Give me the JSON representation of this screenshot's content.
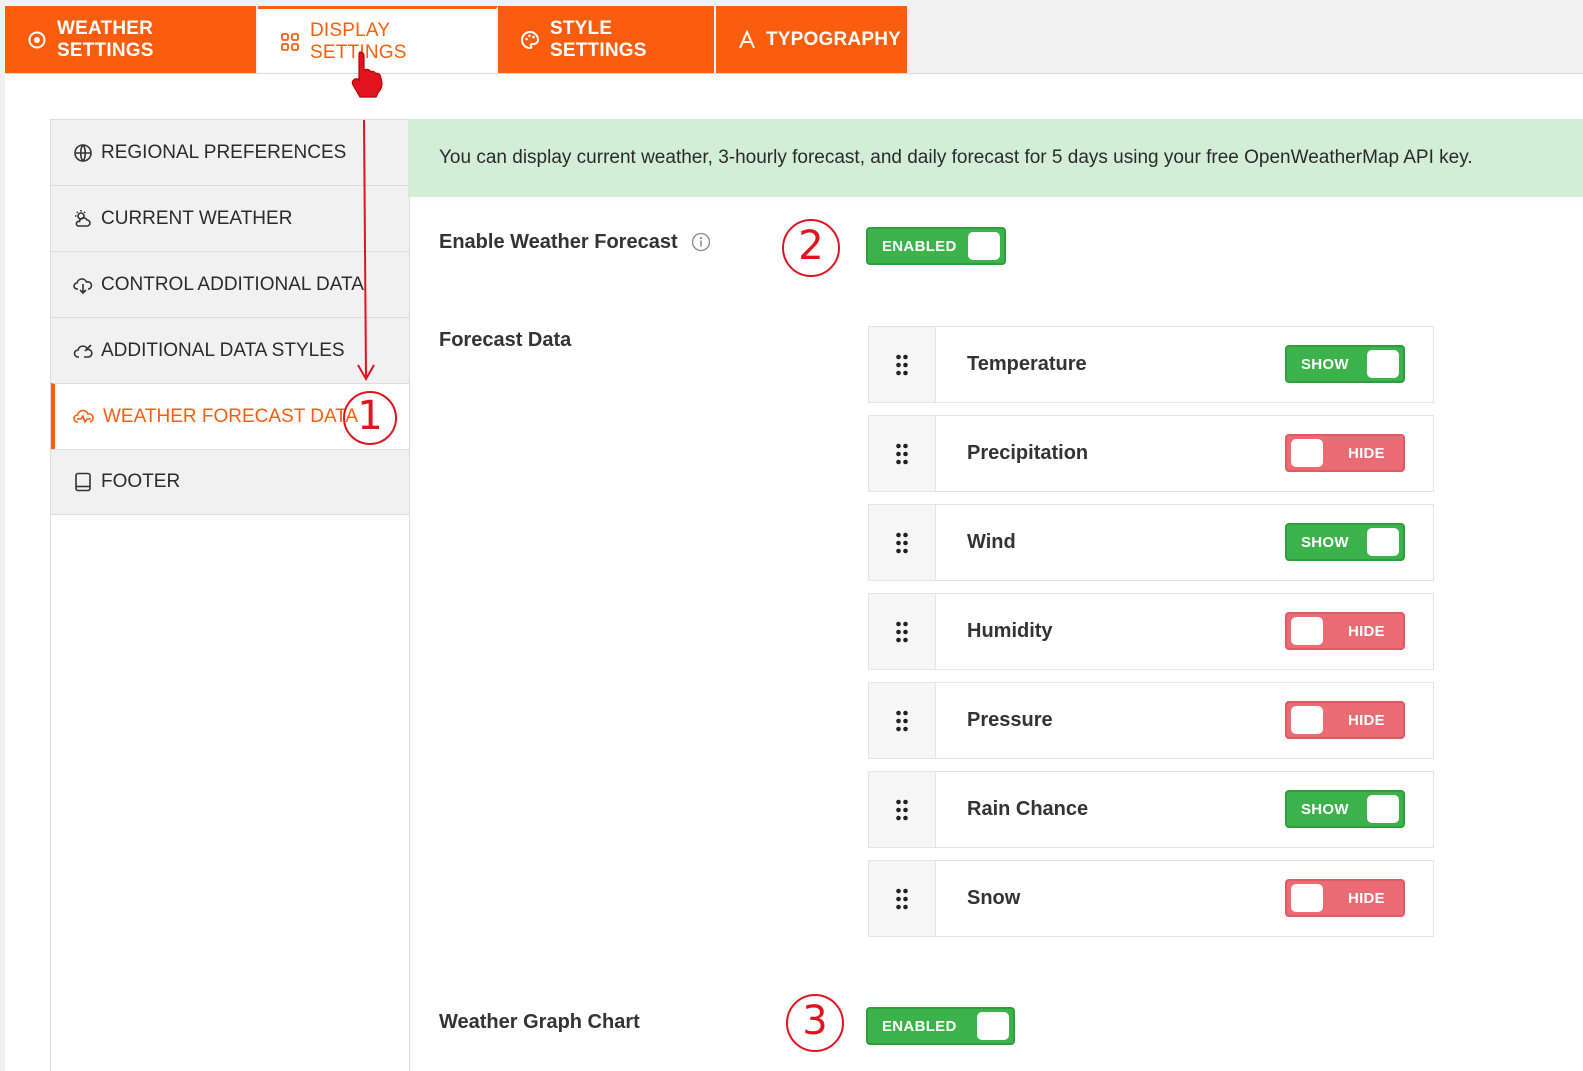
{
  "tabs": [
    {
      "label": "WEATHER SETTINGS",
      "icon": "weather-settings-icon"
    },
    {
      "label": "DISPLAY SETTINGS",
      "icon": "grid-icon"
    },
    {
      "label": "STYLE SETTINGS",
      "icon": "palette-icon"
    },
    {
      "label": "TYPOGRAPHY",
      "icon": "typography-icon"
    }
  ],
  "sidebar": {
    "items": [
      {
        "label": "REGIONAL PREFERENCES",
        "icon": "globe-icon"
      },
      {
        "label": "CURRENT WEATHER",
        "icon": "sun-cloud-icon"
      },
      {
        "label": "CONTROL ADDITIONAL DATA",
        "icon": "cloud-download-icon"
      },
      {
        "label": "ADDITIONAL DATA STYLES",
        "icon": "cloud-brush-icon"
      },
      {
        "label": "WEATHER FORECAST DATA",
        "icon": "cloud-pulse-icon"
      },
      {
        "label": "FOOTER",
        "icon": "tablet-icon"
      }
    ],
    "active_index": 4
  },
  "notice": "You can display current weather, 3-hourly forecast, and daily forecast for 5 days using your free OpenWeatherMap API key.",
  "enable_forecast": {
    "label": "Enable Weather Forecast",
    "state": "ENABLED"
  },
  "forecast_data": {
    "label": "Forecast Data",
    "items": [
      {
        "name": "Temperature",
        "state": "SHOW"
      },
      {
        "name": "Precipitation",
        "state": "HIDE"
      },
      {
        "name": "Wind",
        "state": "SHOW"
      },
      {
        "name": "Humidity",
        "state": "HIDE"
      },
      {
        "name": "Pressure",
        "state": "HIDE"
      },
      {
        "name": "Rain Chance",
        "state": "SHOW"
      },
      {
        "name": "Snow",
        "state": "HIDE"
      }
    ]
  },
  "graph_chart": {
    "label": "Weather Graph Chart",
    "state": "ENABLED"
  },
  "annotations": {
    "step1": "1",
    "step2": "2",
    "step3": "3"
  },
  "colors": {
    "accent": "#fb5d0e",
    "on": "#3cb34a",
    "off": "#ea6b73",
    "notice_bg": "#d2eed7",
    "annotation": "#e0141e"
  }
}
